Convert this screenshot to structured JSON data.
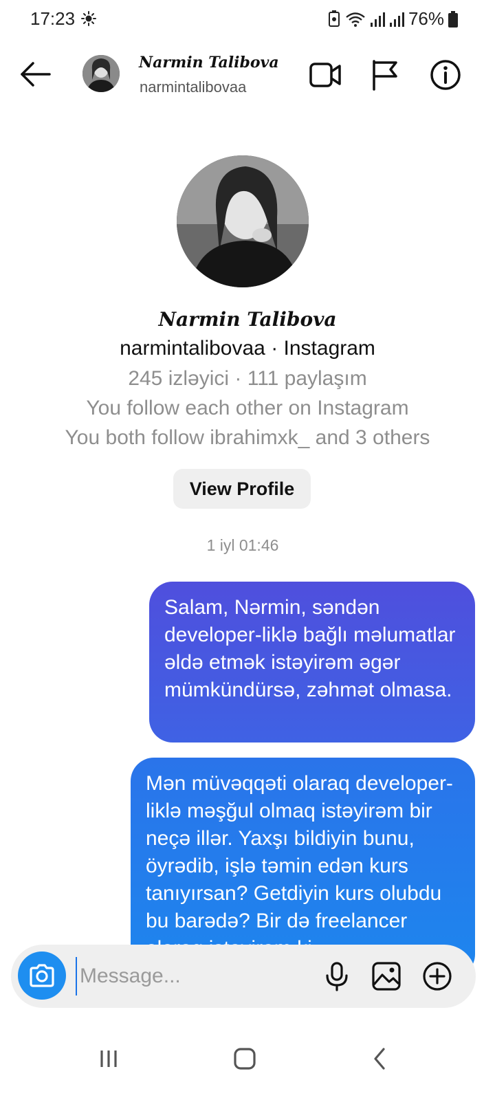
{
  "status_bar": {
    "time": "17:23",
    "battery": "76%"
  },
  "header": {
    "display_name": "Narmin Talibova",
    "username": "narmintalibovaa"
  },
  "profile": {
    "display_name": "Narmin Talibova",
    "handle_line": "narmintalibovaa · Instagram",
    "stats_line": "245 izləyici · 111 paylaşım",
    "follow_line": "You follow each other on Instagram",
    "mutual_line": "You both follow ibrahimxk_ and 3 others",
    "view_profile_label": "View Profile"
  },
  "conversation": {
    "timestamp": "1 iyl 01:46",
    "messages": [
      {
        "text": "Salam, Nərmin, səndən developer-liklə bağlı məlumatlar əldə etmək istəyirəm əgər mümkündürsə, zəhmət olmasa."
      },
      {
        "text": "Mən müvəqqəti olaraq developer-liklə məşğul olmaq istəyirəm bir neçə illər. Yaxşı bildiyin bunu, öyrədib, işlə təmin edən kurs tanıyırsan? Getdiyin kurs olubdu bu barədə? Bir də freelancer olaraq istəyirəm ki"
      }
    ]
  },
  "composer": {
    "placeholder": "Message..."
  },
  "colors": {
    "bubble_top": "#4f4fdd",
    "bubble_bottom": "#1d86ee",
    "camera_blue": "#1e8ef0"
  }
}
